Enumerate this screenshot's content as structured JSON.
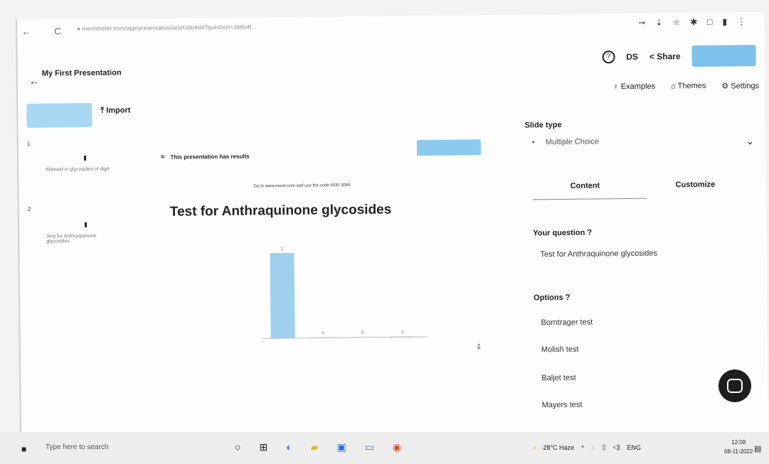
{
  "browser": {
    "back": "←",
    "reload": "C",
    "url": "● mentimeter.com/app/presentation/al/ef/ab/edit?question=1b8c4f...",
    "ext_icons": [
      "⊸",
      "⇣",
      "☆",
      "✱",
      "□",
      "▮",
      "⋮"
    ]
  },
  "header": {
    "back_icon": "←",
    "title": "My First Presentation",
    "help": "?",
    "user": "DS",
    "share": "< Share"
  },
  "top_links": {
    "examples": "♀ Examples",
    "themes": "⌂ Themes",
    "settings": "⚙ Settings"
  },
  "toolbar": {
    "import": "⤒ Import"
  },
  "thumbnails": [
    {
      "number": "1",
      "text": "Allowed in glycosides of digit"
    },
    {
      "number": "2",
      "text": "Test for Anthraquinone glycosides"
    }
  ],
  "slide": {
    "results_text": "This presentation has results",
    "results_icon": "≈",
    "join_text": "Go to www.menti.com and use the code 5635 3094",
    "title": "Test for Anthraquinone glycosides"
  },
  "chart_data": {
    "type": "bar",
    "categories": [
      "",
      "",
      "",
      ""
    ],
    "values": [
      1,
      0,
      0,
      0
    ],
    "ylim": [
      0,
      1
    ]
  },
  "panel": {
    "slide_type_label": "Slide type",
    "slide_type_value": "Multiple Choice",
    "chevron": "⌄",
    "tab_content": "Content",
    "tab_customize": "Customize",
    "question_label": "Your question ?",
    "question_value": "Test for Anthraquinone glycosides",
    "options_label": "Options ?",
    "options": [
      "Borntrager test",
      "Molish test",
      "Baljet test",
      "Mayers test"
    ]
  },
  "taskbar": {
    "search_placeholder": "Type here to search",
    "weather": "28°C Haze",
    "lang": "ENG",
    "time": "12:08",
    "date": "08-11-2022"
  },
  "colors": {
    "accent_blue": "#7fc1ea",
    "bar_blue": "#9fd0ee"
  }
}
